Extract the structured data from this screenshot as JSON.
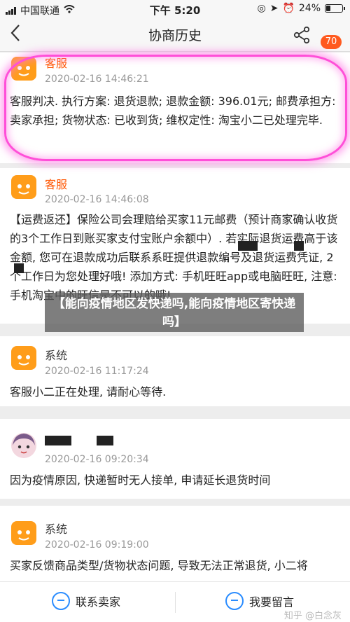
{
  "status_bar": {
    "carrier": "中国联通",
    "time": "下午 5:20",
    "battery": "24%"
  },
  "nav": {
    "title": "协商历史",
    "badge_count": "70"
  },
  "messages": [
    {
      "sender": "客服",
      "time": "2020-02-16 14:46:21",
      "text": "客服判决. 执行方案: 退货退款; 退款金额: 396.01元; 邮费承担方: 卖家承担; 货物状态: 已收到货; 维权定性: 淘宝小二已处理完毕."
    },
    {
      "sender": "客服",
      "time": "2020-02-16 14:46:08",
      "text": "【运费返还】保险公司会理赔给买家11元邮费（预计商家确认收货的3个工作日到账买家支付宝账户余额中）. 若实际退货运费高于该金额, 您可在退款成功后联系系旺提供退款编号及退货运费凭证, 2个工作日为您处理好哦! 添加方式: 手机旺旺app或电脑旺旺, 注意: 手机淘宝中的旺信是不可以的哦!"
    },
    {
      "sender": "系统",
      "time": "2020-02-16 11:17:24",
      "text": "客服小二正在处理, 请耐心等待."
    },
    {
      "sender": "",
      "time": "2020-02-16 09:20:34",
      "text": "因为疫情原因, 快递暂时无人接单, 申请延长退货时间"
    },
    {
      "sender": "系统",
      "time": "2020-02-16 09:19:00",
      "text": "买家反馈商品类型/货物状态问题, 导致无法正常退货, 小二将"
    }
  ],
  "overlay_caption": "【能向疫情地区发快递吗,能向疫情地区寄快递吗】",
  "bottom": {
    "contact_seller": "联系卖家",
    "leave_message": "我要留言"
  },
  "watermark": "知乎 @白念灰",
  "colors": {
    "accent_orange": "#ff5500",
    "highlight_pink": "#ff4fd8",
    "link_blue": "#2a8cff"
  }
}
